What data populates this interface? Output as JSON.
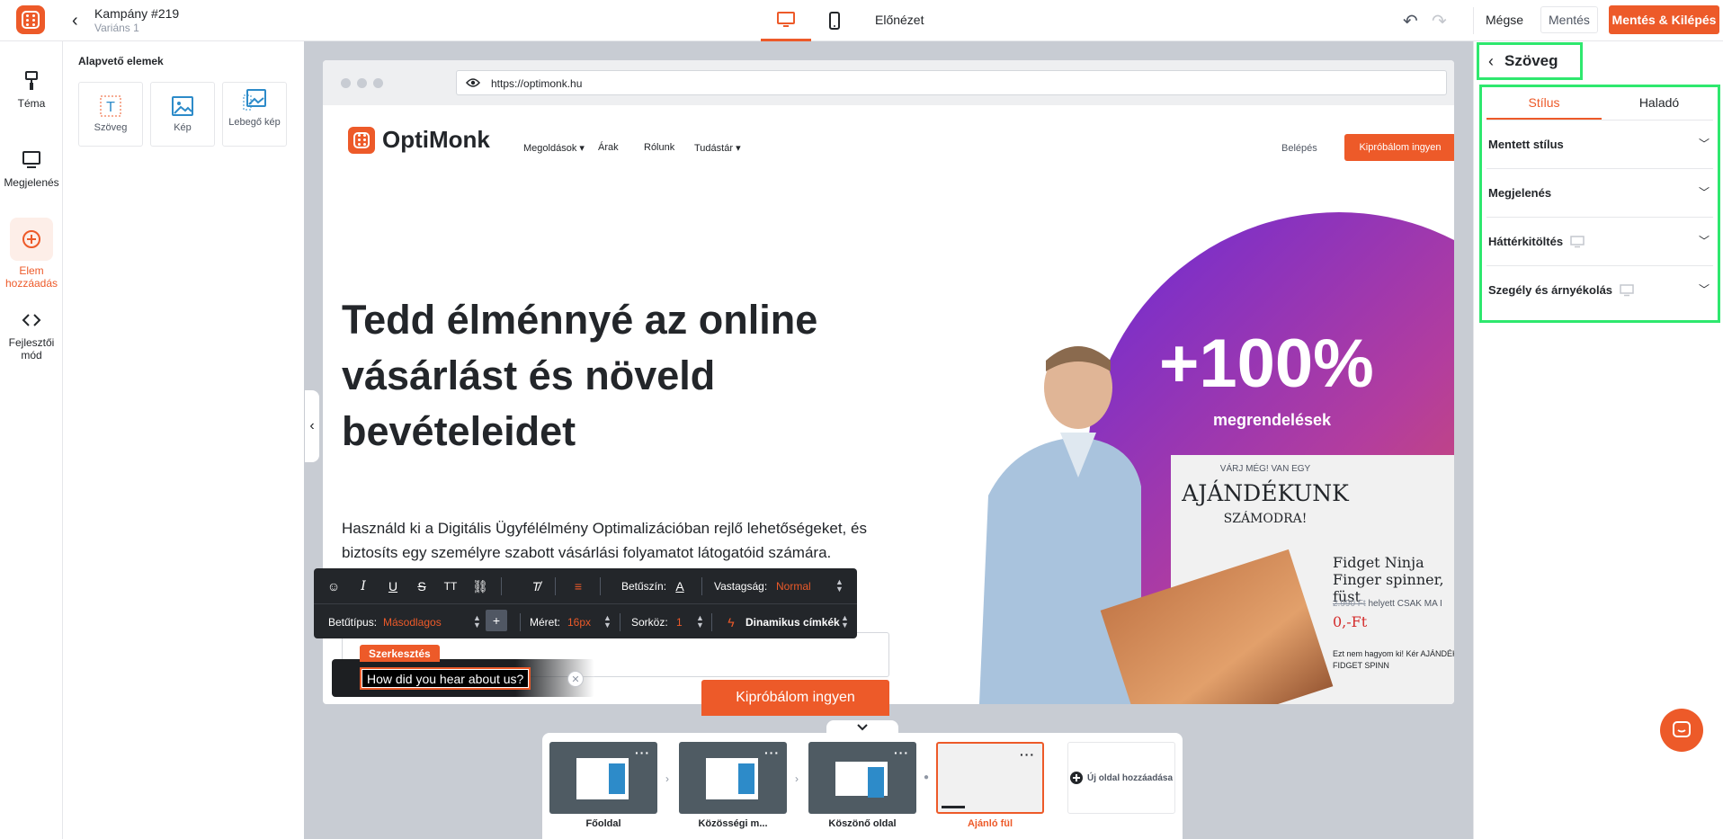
{
  "header": {
    "campaign_title": "Kampány #219",
    "variant": "Variáns 1",
    "preview_label": "Előnézet",
    "cancel_label": "Mégse",
    "save_label": "Mentés",
    "save_exit_label": "Mentés & Kilépés"
  },
  "leftrail": {
    "items": [
      {
        "label": "Téma"
      },
      {
        "label": "Megjelenés"
      },
      {
        "label": "Elem hozzáadás"
      },
      {
        "label": "Fejlesztői mód"
      }
    ]
  },
  "elements_panel": {
    "title": "Alapvető elemek",
    "tiles": [
      {
        "label": "Szöveg",
        "icon": "text-icon"
      },
      {
        "label": "Kép",
        "icon": "image-icon"
      },
      {
        "label": "Lebegő kép",
        "icon": "floating-image-icon"
      }
    ]
  },
  "browser": {
    "url": "https://optimonk.hu"
  },
  "site": {
    "logo_text": "OptiMonk",
    "nav": [
      "Megoldások",
      "Árak",
      "Rólunk",
      "Tudástár"
    ],
    "login": "Belépés",
    "cta": "Kipróbálom ingyen",
    "hero_title": "Tedd élménnyé az online vásárlást és növeld bevételeidet",
    "hero_desc": "Használd ki a Digitális Ügyfélélmény Optimalizációban rejlő lehetőségeket, és biztosíts egy személyre szabott vásárlási folyamatot látogatóid számára.",
    "hero_button": "Kipróbálom ingyen",
    "badge_main": "+100%",
    "badge_sub": "megrendelések",
    "card_small": "VÁRJ MÉG! VAN EGY",
    "card_big": "AJÁNDÉKUNK",
    "card_mid": "SZÁMODRA!",
    "card_product": "Fidget Ninja Finger spinner, füst",
    "card_old_price": "2.990 Ft",
    "card_old_suffix": "helyett CSAK MA I",
    "card_price": "0,-Ft",
    "card_note": "Ezt nem hagyom ki! Kér AJÁNDÉK FIDGET SPINN"
  },
  "toolbar": {
    "font_color_label": "Betűszín:",
    "weight_label": "Vastagság:",
    "weight_value": "Normal",
    "font_label": "Betűtípus:",
    "font_value": "Másodlagos",
    "size_label": "Méret:",
    "size_value": "16px",
    "line_label": "Sorköz:",
    "line_value": "1",
    "dynamic_label": "Dinamikus címkék"
  },
  "selection": {
    "tag": "Szerkesztés",
    "text": "How did you hear about us?"
  },
  "pages": {
    "items": [
      {
        "label": "Főoldal"
      },
      {
        "label": "Közösségi m..."
      },
      {
        "label": "Köszönő oldal"
      },
      {
        "label": "Ajánló fül"
      }
    ],
    "add_label": "Új oldal hozzáadása"
  },
  "rightpanel": {
    "title": "Szöveg",
    "tabs": [
      "Stílus",
      "Haladó"
    ],
    "sections": [
      {
        "label": "Mentett stílus"
      },
      {
        "label": "Megjelenés"
      },
      {
        "label": "Háttérkitöltés"
      },
      {
        "label": "Szegély és árnyékolás"
      }
    ]
  },
  "colors": {
    "accent": "#ed5a29",
    "highlight": "#2ee86e",
    "dark": "#23262a"
  }
}
